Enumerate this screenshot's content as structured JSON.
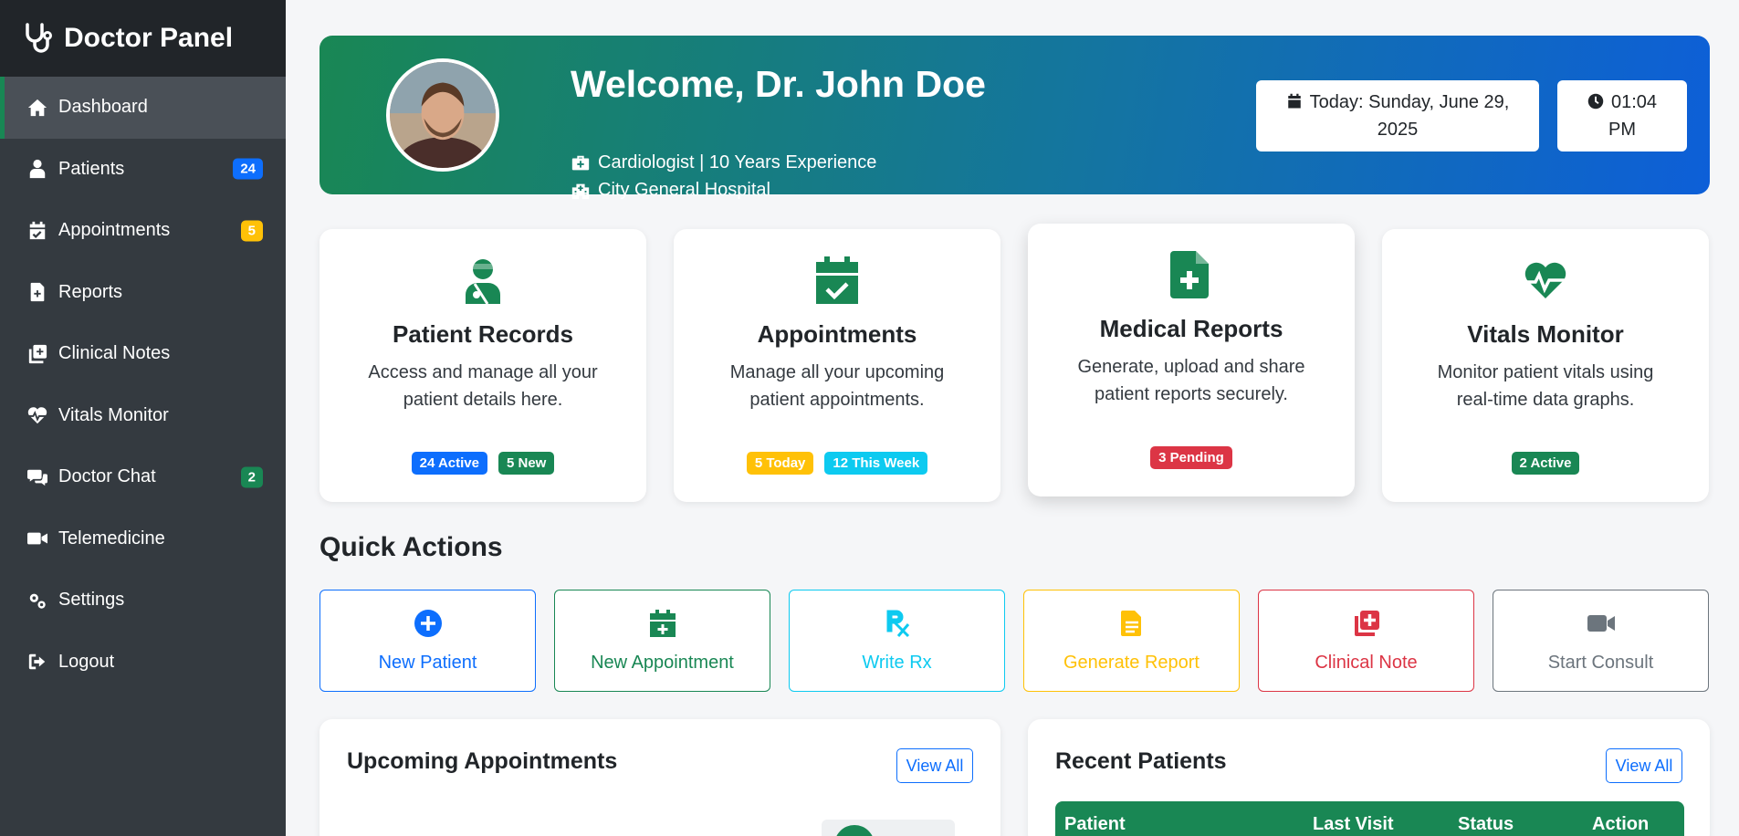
{
  "sidebar": {
    "brand": "Doctor Panel",
    "items": [
      {
        "label": "Dashboard",
        "icon": "home-icon",
        "active": true
      },
      {
        "label": "Patients",
        "icon": "user-injured-icon",
        "badge": "24",
        "badge_color": "#0d6efd"
      },
      {
        "label": "Appointments",
        "icon": "calendar-check-icon",
        "badge": "5",
        "badge_color": "#ffc107"
      },
      {
        "label": "Reports",
        "icon": "file-medical-icon"
      },
      {
        "label": "Clinical Notes",
        "icon": "notes-medical-icon"
      },
      {
        "label": "Vitals Monitor",
        "icon": "heart-pulse-icon"
      },
      {
        "label": "Doctor Chat",
        "icon": "comments-icon",
        "badge": "2",
        "badge_color": "#198754"
      },
      {
        "label": "Telemedicine",
        "icon": "video-icon"
      },
      {
        "label": "Settings",
        "icon": "gears-icon"
      },
      {
        "label": "Logout",
        "icon": "sign-out-icon"
      }
    ]
  },
  "banner": {
    "welcome": "Welcome, Dr. John Doe",
    "specialty": "Cardiologist | 10 Years Experience",
    "hospital": "City General Hospital",
    "date_line1": "Today: Sunday, June 29,",
    "date_line2": "2025",
    "time_line1": "01:04",
    "time_line2": "PM"
  },
  "cards": [
    {
      "title": "Patient Records",
      "desc": "Access and manage all your patient details here.",
      "icon": "user-injured-icon",
      "badges": [
        {
          "text": "24 Active",
          "color": "#0d6efd"
        },
        {
          "text": "5 New",
          "color": "#198754"
        }
      ]
    },
    {
      "title": "Appointments",
      "desc": "Manage all your upcoming patient appointments.",
      "icon": "calendar-check-icon",
      "badges": [
        {
          "text": "5 Today",
          "color": "#ffc107"
        },
        {
          "text": "12 This Week",
          "color": "#0dcaf0"
        }
      ]
    },
    {
      "title": "Medical Reports",
      "desc": "Generate, upload and share patient reports securely.",
      "icon": "file-medical-icon",
      "badges": [
        {
          "text": "3 Pending",
          "color": "#dc3545"
        }
      ]
    },
    {
      "title": "Vitals Monitor",
      "desc": "Monitor patient vitals using real-time data graphs.",
      "icon": "heart-pulse-icon",
      "badges": [
        {
          "text": "2 Active",
          "color": "#198754"
        }
      ]
    }
  ],
  "quick_actions": {
    "title": "Quick Actions",
    "buttons": [
      {
        "label": "New Patient",
        "icon": "plus-circle-icon",
        "color": "#0d6efd"
      },
      {
        "label": "New Appointment",
        "icon": "calendar-plus-icon",
        "color": "#198754"
      },
      {
        "label": "Write Rx",
        "icon": "prescription-icon",
        "color": "#0dcaf0"
      },
      {
        "label": "Generate Report",
        "icon": "file-lines-icon",
        "color": "#ffc107"
      },
      {
        "label": "Clinical Note",
        "icon": "notes-medical-icon",
        "color": "#dc3545"
      },
      {
        "label": "Start Consult",
        "icon": "video-icon",
        "color": "#6c757d"
      }
    ]
  },
  "upcoming": {
    "title": "Upcoming Appointments",
    "view_all": "View All"
  },
  "recent": {
    "title": "Recent Patients",
    "view_all": "View All",
    "columns": [
      "Patient",
      "Last Visit",
      "Status",
      "Action"
    ]
  }
}
